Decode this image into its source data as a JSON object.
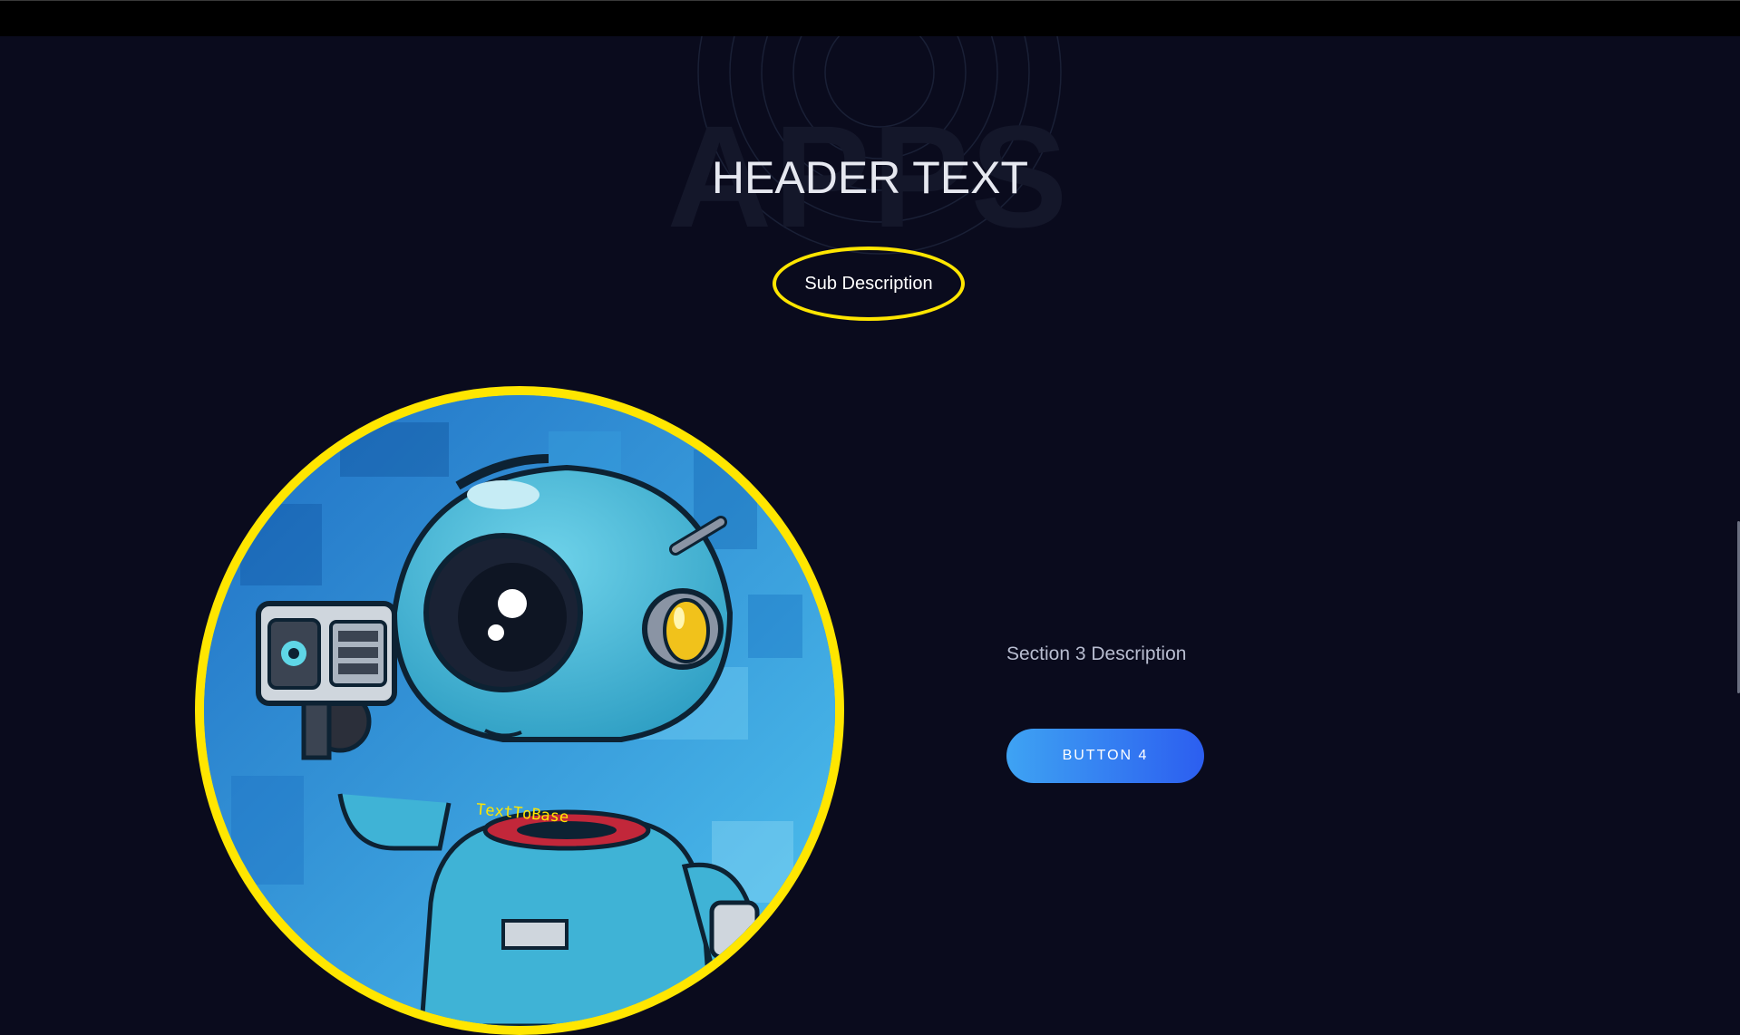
{
  "header": {
    "watermark": "APPS",
    "title": "HEADER TEXT",
    "sub_description": "Sub Description"
  },
  "section3": {
    "description": "Section 3 Description",
    "button_label": "BUTTON 4"
  },
  "hero": {
    "shirt_text": "TextToBase"
  },
  "colors": {
    "background": "#0a0b1d",
    "accent_yellow": "#ffe600",
    "button_gradient_start": "#3ea3f3",
    "button_gradient_end": "#2c5ef0"
  },
  "icons": {
    "hero_image": "robot-with-camera-illustration"
  }
}
